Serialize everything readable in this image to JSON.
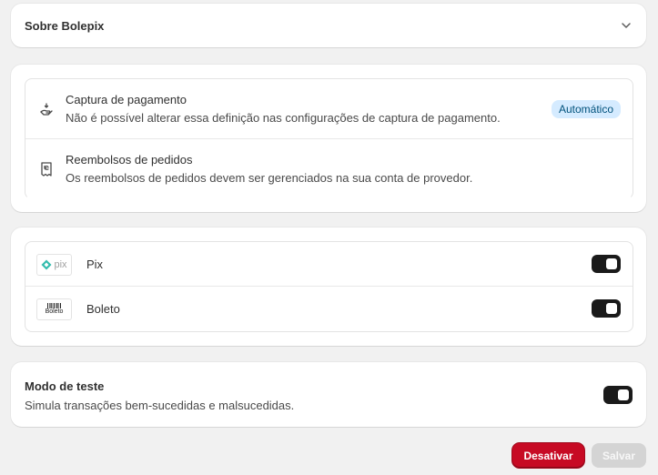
{
  "about": {
    "title": "Sobre Bolepix"
  },
  "settings": [
    {
      "title": "Captura de pagamento",
      "description": "Não é possível alterar essa definição nas configurações de captura de pagamento.",
      "badge": "Automático",
      "icon": "hand-payment-icon"
    },
    {
      "title": "Reembolsos de pedidos",
      "description": "Os reembolsos de pedidos devem ser gerenciados na sua conta de provedor.",
      "icon": "receipt-refund-icon"
    }
  ],
  "payment_methods": [
    {
      "label": "Pix",
      "logo_text": "pix",
      "enabled": true
    },
    {
      "label": "Boleto",
      "logo_text": "Boleto",
      "enabled": true
    }
  ],
  "test_mode": {
    "title": "Modo de teste",
    "description": "Simula transações bem-sucedidas e malsucedidas.",
    "enabled": true
  },
  "actions": {
    "deactivate": "Desativar",
    "save": "Salvar"
  },
  "colors": {
    "toggle_on": "#1a1a1a",
    "badge_bg": "#d5ebff",
    "badge_text": "#00527c",
    "danger": "#c70a24",
    "disabled_button": "#d4d4d4",
    "pix_teal": "#32bcad"
  }
}
